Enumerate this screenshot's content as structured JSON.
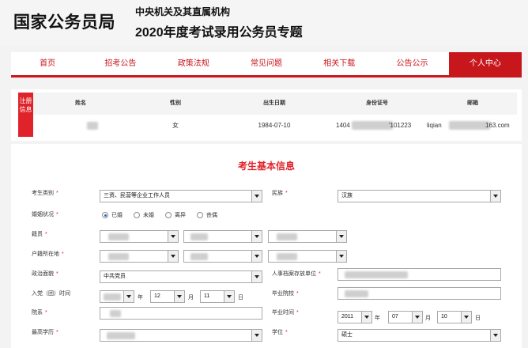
{
  "header": {
    "brand": "国家公务员局",
    "subtitle1": "中央机关及其直属机构",
    "subtitle2": "2020年度考试录用公务员专题"
  },
  "nav": {
    "items": [
      "首页",
      "招考公告",
      "政策法规",
      "常见问题",
      "相关下载",
      "公告公示",
      "个人中心"
    ],
    "active_index": 6
  },
  "registration": {
    "tab_label": "注册信息",
    "headers": [
      "姓名",
      "性别",
      "出生日期",
      "身份证号",
      "邮箱"
    ],
    "values": {
      "gender": "女",
      "birth_date": "1984-07-10",
      "id_prefix": "1404",
      "id_suffix": "'101223",
      "email_prefix": "liqian",
      "email_suffix": "163.com"
    }
  },
  "form": {
    "title": "考生基本信息",
    "labels": {
      "category": "考生类别",
      "ethnicity": "民族",
      "marital": "婚姻状况",
      "native_place": "籍贯",
      "household": "户籍所在地",
      "political": "政治面貌",
      "archive": "人事档案存放单位",
      "join_date": "入党（团）时间",
      "school": "毕业院校",
      "department": "院系",
      "grad_time": "毕业时间",
      "education": "最高学历",
      "degree": "学位"
    },
    "required_mark": "*",
    "values": {
      "category": "三资、民营等企业工作人员",
      "ethnicity": "汉族",
      "political": "中共党员",
      "join_month": "12",
      "join_day": "11",
      "grad_year": "2011",
      "grad_month": "07",
      "grad_day": "10",
      "degree": "硕士"
    },
    "marital_options": [
      "已婚",
      "未婚",
      "离异",
      "丧偶"
    ],
    "marital_selected": 0,
    "units": {
      "year": "年",
      "month": "月",
      "day": "日"
    }
  },
  "colors": {
    "brand_red": "#c8161d",
    "tab_red": "#e0232b",
    "radio_blue": "#1a66d1"
  }
}
